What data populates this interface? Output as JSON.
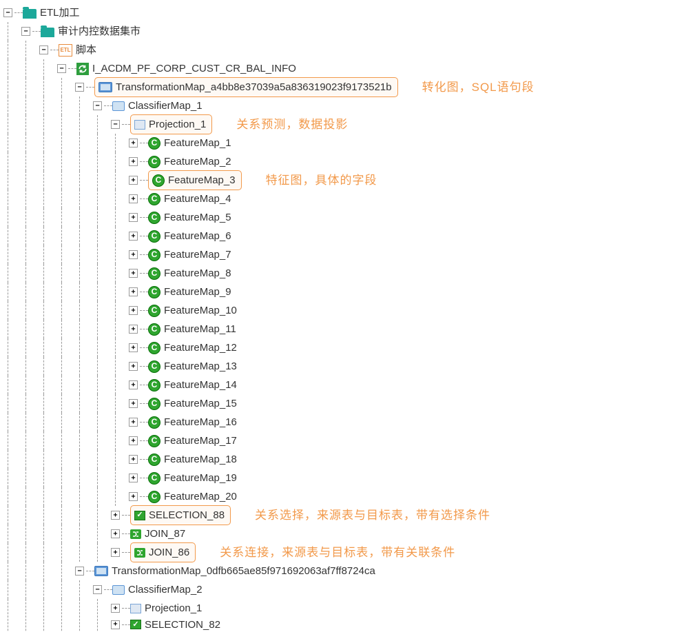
{
  "tree": {
    "etl_root": "ETL加工",
    "datamart": "审计内控数据集市",
    "script": "脚本",
    "job": "I_ACDM_PF_CORP_CUST_CR_BAL_INFO",
    "tmap1": "TransformationMap_a4bb8e37039a5a836319023f9173521b",
    "tmap1_anno": "转化图，SQL语句段",
    "classifier1": "ClassifierMap_1",
    "projection1": "Projection_1",
    "projection1_anno": "关系预测，数据投影",
    "feature_label": "FeatureMap_",
    "feature_items": [
      "1",
      "2",
      "3",
      "4",
      "5",
      "6",
      "7",
      "8",
      "9",
      "10",
      "11",
      "12",
      "13",
      "14",
      "15",
      "16",
      "17",
      "18",
      "19",
      "20"
    ],
    "feature3_anno": "特征图，具体的字段",
    "selection88": "SELECTION_88",
    "selection88_anno": "关系选择，来源表与目标表，带有选择条件",
    "join87": "JOIN_87",
    "join86": "JOIN_86",
    "join86_anno": "关系连接，来源表与目标表，带有关联条件",
    "tmap2": "TransformationMap_0dfb665ae85f971692063af7ff8724ca",
    "classifier2": "ClassifierMap_2",
    "projection2_1": "Projection_1",
    "selection82": "SELECTION_82"
  },
  "toggles": {
    "minus": "−",
    "plus": "+"
  }
}
